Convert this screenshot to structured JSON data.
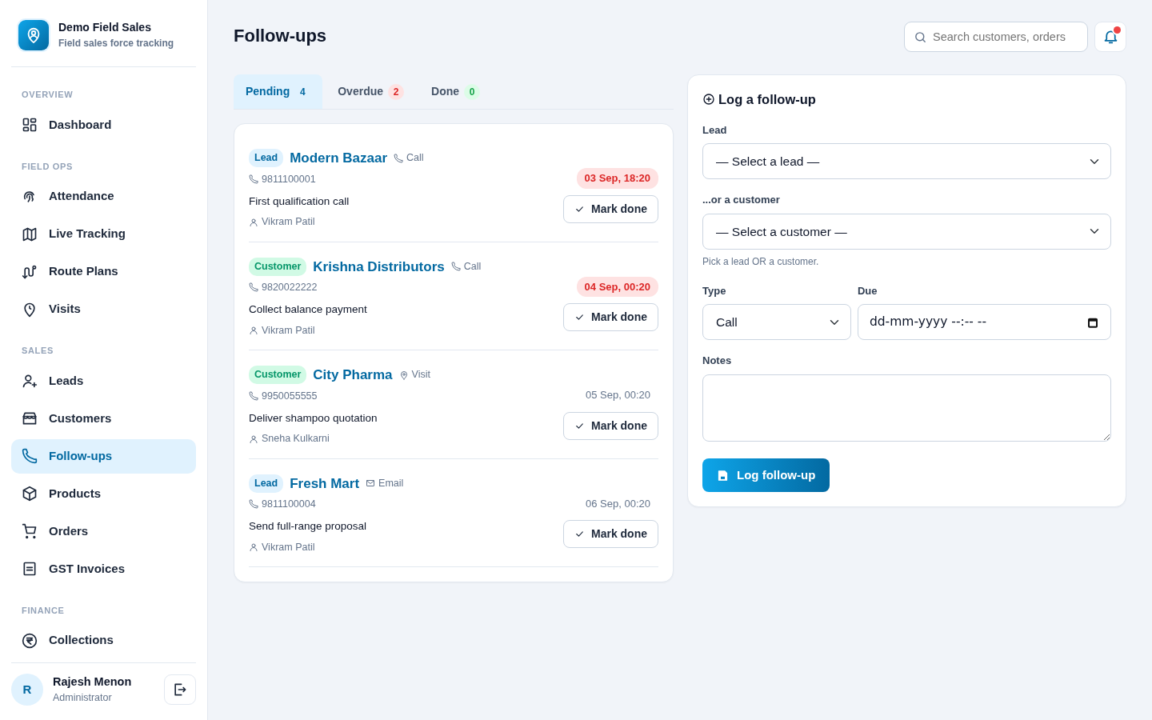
{
  "brand": {
    "title": "Demo Field Sales",
    "subtitle": "Field sales force tracking"
  },
  "sidebar": {
    "sections": [
      {
        "title": "OVERVIEW",
        "items": [
          {
            "label": "Dashboard",
            "selected": false
          }
        ]
      },
      {
        "title": "FIELD OPS",
        "items": [
          {
            "label": "Attendance",
            "selected": false
          },
          {
            "label": "Live Tracking",
            "selected": false
          },
          {
            "label": "Route Plans",
            "selected": false
          },
          {
            "label": "Visits",
            "selected": false
          }
        ]
      },
      {
        "title": "SALES",
        "items": [
          {
            "label": "Leads",
            "selected": false
          },
          {
            "label": "Customers",
            "selected": false
          },
          {
            "label": "Follow-ups",
            "selected": true
          },
          {
            "label": "Products",
            "selected": false
          },
          {
            "label": "Orders",
            "selected": false
          },
          {
            "label": "GST Invoices",
            "selected": false
          }
        ]
      },
      {
        "title": "FINANCE",
        "items": [
          {
            "label": "Collections",
            "selected": false
          }
        ]
      }
    ]
  },
  "user": {
    "initial": "R",
    "name": "Rajesh Menon",
    "role": "Administrator"
  },
  "page_title": "Follow-ups",
  "search": {
    "placeholder": "Search customers, orders"
  },
  "notifications": {
    "unread": true
  },
  "tabs": [
    {
      "label": "Pending",
      "count": "4",
      "kind": "neutral",
      "selected": true
    },
    {
      "label": "Overdue",
      "count": "2",
      "kind": "danger",
      "selected": false
    },
    {
      "label": "Done",
      "count": "0",
      "kind": "success",
      "selected": false
    }
  ],
  "followups": [
    {
      "tag": "Lead",
      "kind": "lead",
      "name": "Modern Bazaar",
      "type": {
        "kind": "call",
        "label": "Call"
      },
      "phone": "9811100001",
      "note": "First qualification call",
      "assignee": "Vikram Patil",
      "due": "03 Sep, 18:20",
      "overdue": true,
      "action": "Mark done"
    },
    {
      "tag": "Customer",
      "kind": "customer",
      "name": "Krishna Distributors",
      "type": {
        "kind": "call",
        "label": "Call"
      },
      "phone": "9820022222",
      "note": "Collect balance payment",
      "assignee": "Vikram Patil",
      "due": "04 Sep, 00:20",
      "overdue": true,
      "action": "Mark done"
    },
    {
      "tag": "Customer",
      "kind": "customer",
      "name": "City Pharma",
      "type": {
        "kind": "visit",
        "label": "Visit"
      },
      "phone": "9950055555",
      "note": "Deliver shampoo quotation",
      "assignee": "Sneha Kulkarni",
      "due": "05 Sep, 00:20",
      "overdue": false,
      "action": "Mark done"
    },
    {
      "tag": "Lead",
      "kind": "lead",
      "name": "Fresh Mart",
      "type": {
        "kind": "email",
        "label": "Email"
      },
      "phone": "9811100004",
      "note": "Send full-range proposal",
      "assignee": "Vikram Patil",
      "due": "06 Sep, 00:20",
      "overdue": false,
      "action": "Mark done"
    }
  ],
  "form": {
    "title": "Log a follow-up",
    "lead": {
      "label": "Lead",
      "value": "— Select a lead —"
    },
    "customer": {
      "label": "...or a customer",
      "value": "— Select a customer —"
    },
    "hint": "Pick a lead OR a customer.",
    "type": {
      "label": "Type",
      "value": "Call"
    },
    "due": {
      "label": "Due",
      "value": "dd-mm-yyyy --:-- --"
    },
    "notes": {
      "label": "Notes"
    },
    "submit": "Log follow-up"
  }
}
